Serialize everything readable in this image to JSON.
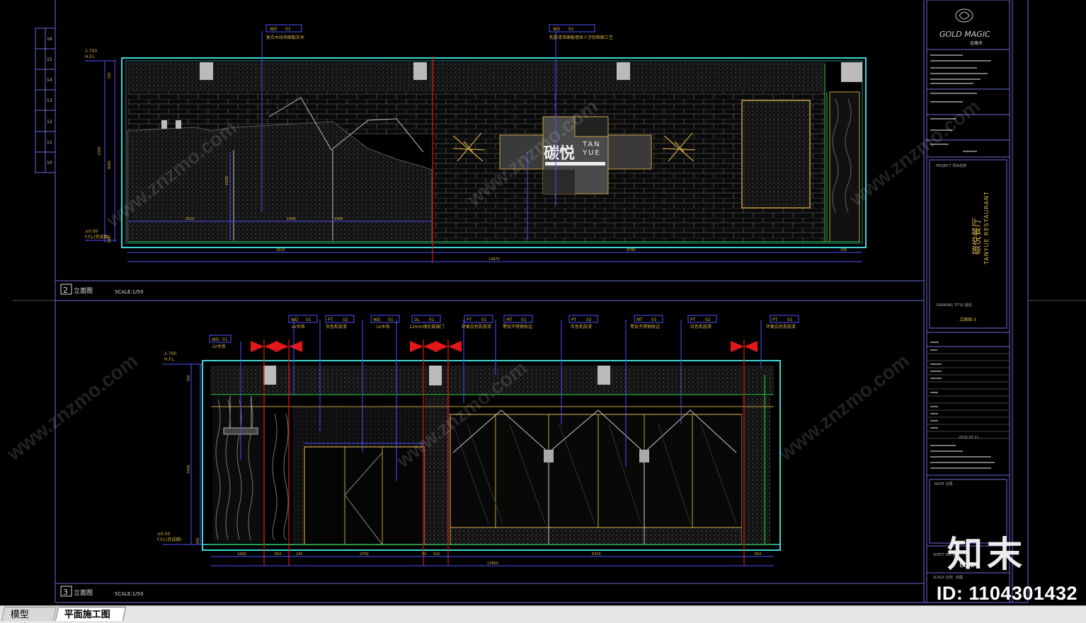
{
  "drawing": {
    "elevation_2": {
      "number": "2",
      "title": "立面图",
      "scale": "SCALE:1/50",
      "level_top": "2.700",
      "level_sub": "H.F.L",
      "level_floor": "±0.00",
      "level_floor_sub": "F.F.L(完成面)",
      "dims_vertical": [
        "700",
        "2300",
        "3000",
        "1500",
        "300"
      ],
      "dims_bottom": [
        "2010",
        "1940",
        "1400",
        "2010",
        "9780",
        "295"
      ],
      "dim_total": "14675",
      "sign_text_cn": "碳悦",
      "sign_text_en1": "TAN",
      "sign_text_en2": "YUE",
      "callouts": [
        {
          "tag": "WD",
          "no": "01",
          "desc": "复合木纹饰面板实木"
        },
        {
          "tag": "WD",
          "no": "01",
          "desc": "乳胶漆饰面板墙体人字形图案工艺"
        }
      ]
    },
    "elevation_3": {
      "number": "3",
      "title": "立面图",
      "scale": "SCALE:1/50",
      "level_top": "2.700",
      "level_sub": "H.F.L",
      "level_floor": "±0.00",
      "level_floor_sub": "F.F.L(完成面)",
      "dims_vertical": [
        "700",
        "3400",
        "300"
      ],
      "dims_bottom": [
        "1800",
        "650",
        "240",
        "2700",
        "50",
        "505",
        "6300",
        "650"
      ],
      "dim_total": "13860",
      "callouts": [
        {
          "tag": "WD",
          "no": "01",
          "desc": "LV木饰"
        },
        {
          "tag": "WD",
          "no": "01",
          "desc": "LV木饰"
        },
        {
          "tag": "PT",
          "no": "02",
          "desc": "灰色乳胶漆"
        },
        {
          "tag": "WD",
          "no": "01",
          "desc": "LV木饰"
        },
        {
          "tag": "GL",
          "no": "01",
          "desc": "12mm钢化玻璃门"
        },
        {
          "tag": "PT",
          "no": "01",
          "desc": "环氧白色乳胶漆"
        },
        {
          "tag": "MT",
          "no": "01",
          "desc": "黑钛不锈钢收边"
        },
        {
          "tag": "PT",
          "no": "02",
          "desc": "灰色乳胶漆"
        },
        {
          "tag": "MT",
          "no": "01",
          "desc": "黑钛不锈钢收边"
        },
        {
          "tag": "PT",
          "no": "02",
          "desc": "白色乳胶漆"
        },
        {
          "tag": "PT",
          "no": "01",
          "desc": "环氧白色乳胶漆"
        }
      ]
    }
  },
  "title_block": {
    "company_logo": "GOLD MAGIC",
    "company_sub": "金魔术",
    "project_cn": "碳悦餐厅",
    "project_en": "TANYUE RESTAURANT",
    "project_label": "PROJECT 项目名称",
    "drawing_title_label": "DRAWING TITLE 图名",
    "drawing_title": "立面图-3",
    "date": "2016.05.31",
    "sheet_no_label": "SHEET No. 图号",
    "sheet_no": "EL-2",
    "note_label": "NOTE 注释",
    "scale_label": "SCALE 比例",
    "scale_value": "如图"
  },
  "left_ruler_rows": [
    "16",
    "15",
    "14",
    "13",
    "12",
    "11",
    "10"
  ],
  "tabs": [
    "模型",
    "平面施工图"
  ],
  "watermarks": {
    "id": "ID: 1104301432",
    "logo": "知末",
    "repeat": "www.znzmo.com"
  },
  "colors": {
    "background": "#000000",
    "frame_blue": "#6b6bd8",
    "floor_cyan": "#3fd6d6",
    "gold": "#c9a041",
    "dim_blue": "#4f4fff",
    "red_axis": "#e01818",
    "green": "#2ed34a"
  }
}
